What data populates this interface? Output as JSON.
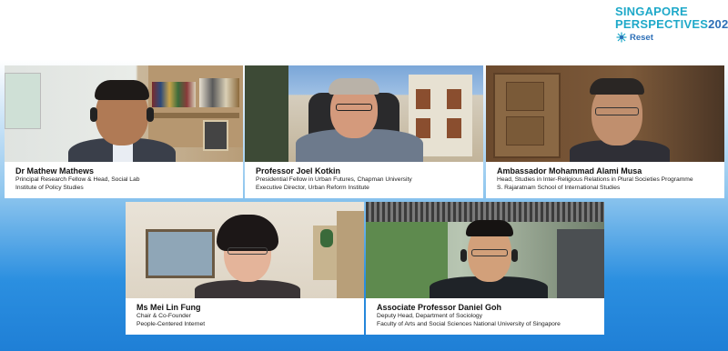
{
  "logo": {
    "line1": "SINGAPORE",
    "line2": "PERSPECTIVES",
    "year": "2021",
    "tag": "Reset",
    "icon": "sun-burst-icon"
  },
  "participants": [
    {
      "name": "Dr Mathew Mathews",
      "line1": "Principal Research Fellow & Head, Social Lab",
      "line2": "Institute of Policy Studies"
    },
    {
      "name": "Professor Joel Kotkin",
      "line1": "Presidential Fellow in Urban Futures, Chapman University",
      "line2": "Executive Director, Urban Reform Institute"
    },
    {
      "name": "Ambassador Mohammad Alami Musa",
      "line1": "Head, Studies in Inter-Religious Relations in Plural Societies Programme",
      "line2": "S. Rajaratnam School of International Studies"
    },
    {
      "name": "Ms Mei Lin Fung",
      "line1": "Chair & Co-Founder",
      "line2": "People-Centered Internet"
    },
    {
      "name": "Associate Professor Daniel Goh",
      "line1": "Deputy Head, Department of Sociology",
      "line2": "Faculty of Arts and Social Sciences National University of Singapore"
    }
  ],
  "colors": {
    "brand_teal": "#1fa9c9",
    "brand_blue": "#2d6fb7",
    "background_blue": "#2b8fe0"
  }
}
